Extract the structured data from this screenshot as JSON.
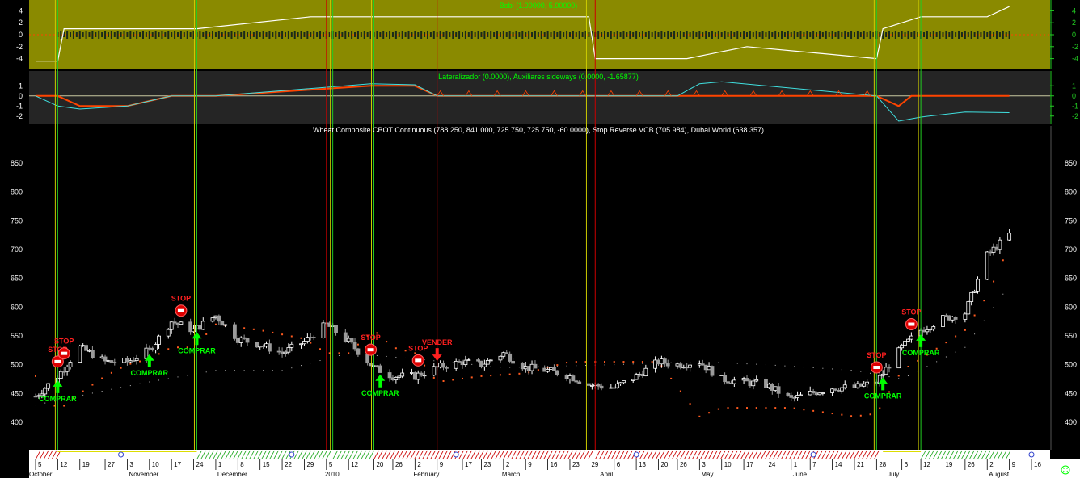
{
  "panels": {
    "bobi": {
      "title": "Bobi (1.00000, 5.00000)",
      "ticks": [
        "4",
        "2",
        "0",
        "-2",
        "-4"
      ],
      "tick_values": [
        4,
        2,
        0,
        -2,
        -4
      ],
      "bg_color": "#8a8a00"
    },
    "lateralizador": {
      "title": "Lateralizador (0.0000), Auxiliares sideways (0.0000, -1.65877)",
      "ticks": [
        "1",
        "0",
        "-1",
        "-2"
      ],
      "tick_values": [
        1,
        0,
        -1,
        -2
      ]
    },
    "price": {
      "title": "Wheat Composite CBOT Continuous (788.250, 841.000, 725.750, 725.750, -60.0000), Stop Reverse VCB (705.984), Dubai World (638.357)",
      "ticks": [
        "850",
        "800",
        "750",
        "700",
        "650",
        "600",
        "550",
        "500",
        "450",
        "400"
      ],
      "tick_values": [
        850,
        800,
        750,
        700,
        650,
        600,
        550,
        500,
        450,
        400
      ]
    }
  },
  "signals": [
    {
      "label": "COMPRAR",
      "kind": "buy",
      "date": "Oct 12"
    },
    {
      "label": "STOP",
      "kind": "stop",
      "date": "Oct 12"
    },
    {
      "label": "STOP",
      "kind": "stop",
      "date": "Oct 14"
    },
    {
      "label": "COMPRAR",
      "kind": "buy",
      "date": "Nov 10"
    },
    {
      "label": "STOP",
      "kind": "stop",
      "date": "Nov 20"
    },
    {
      "label": "COMPRAR",
      "kind": "buy",
      "date": "Nov 25"
    },
    {
      "label": "STOP",
      "kind": "stop",
      "date": "Jan 19"
    },
    {
      "label": "COMPRAR",
      "kind": "buy",
      "date": "Jan 22"
    },
    {
      "label": "STOP",
      "kind": "stop",
      "date": "Feb 3"
    },
    {
      "label": "VENDER",
      "kind": "sell",
      "date": "Feb 9"
    },
    {
      "label": "STOP",
      "kind": "stop",
      "date": "Jun 28"
    },
    {
      "label": "COMPRAR",
      "kind": "buy",
      "date": "Jun 30"
    },
    {
      "label": "STOP",
      "kind": "stop",
      "date": "Jul 9"
    },
    {
      "label": "COMPRAR",
      "kind": "buy",
      "date": "Jul 12"
    }
  ],
  "x_axis": {
    "day_ticks": [
      "5",
      "12",
      "19",
      "27",
      "3",
      "10",
      "17",
      "24",
      "1",
      "8",
      "15",
      "22",
      "29",
      "5",
      "12",
      "20",
      "26",
      "2",
      "9",
      "17",
      "23",
      "2",
      "9",
      "16",
      "23",
      "29",
      "6",
      "13",
      "20",
      "26",
      "3",
      "10",
      "17",
      "24",
      "1",
      "7",
      "14",
      "21",
      "28",
      "6",
      "12",
      "19",
      "26",
      "2",
      "9",
      "16"
    ],
    "months": [
      "October",
      "November",
      "December",
      "2010",
      "February",
      "March",
      "April",
      "May",
      "June",
      "July",
      "August"
    ]
  },
  "chart_data": [
    {
      "type": "line",
      "title": "Bobi (1.00000, 5.00000)",
      "ylim": [
        -5,
        5
      ],
      "series": [
        {
          "name": "Bobi",
          "color": "#ffffff",
          "x": [
            "Oct 5",
            "Oct 12",
            "Oct 14",
            "Nov 25",
            "Dec 31",
            "Jan 19",
            "Feb 9",
            "Mar 29",
            "Mar 31",
            "Apr 29",
            "May 18",
            "Jun 28",
            "Jun 30",
            "Jul 12",
            "Aug 2",
            "Aug 9"
          ],
          "values": [
            -4.4,
            -4.4,
            1.0,
            1.0,
            3.0,
            3.0,
            3.0,
            3.0,
            -4.0,
            -4.0,
            -2.0,
            -4.0,
            1.0,
            3.0,
            3.0,
            4.7
          ]
        }
      ]
    },
    {
      "type": "line",
      "title": "Lateralizador (0.0000), Auxiliares sideways (0.0000, -1.65877)",
      "ylim": [
        -2.5,
        1.5
      ],
      "series": [
        {
          "name": "Lateralizador",
          "color": "#ff4400",
          "x": [
            "Oct 5",
            "Oct 12",
            "Oct 19",
            "Nov 3",
            "Nov 17",
            "Dec 1",
            "Jan 19",
            "Feb 2",
            "Feb 9",
            "Jun 28",
            "Jul 5",
            "Jul 9",
            "Aug 9"
          ],
          "values": [
            0,
            0,
            -1,
            -1,
            0,
            0,
            1,
            1,
            0,
            0,
            -1,
            0,
            0
          ]
        },
        {
          "name": "Auxiliares sideways",
          "color": "#40e0e0",
          "x": [
            "Oct 5",
            "Oct 12",
            "Oct 19",
            "Nov 3",
            "Nov 17",
            "Dec 1",
            "Jan 19",
            "Feb 2",
            "Feb 9",
            "Apr 26",
            "May 3",
            "May 10",
            "Jun 28",
            "Jul 5",
            "Jul 12",
            "Jul 26",
            "Aug 9"
          ],
          "values": [
            0,
            -1.0,
            -1.3,
            -1.0,
            0,
            0,
            1.2,
            1.1,
            0,
            0,
            1.2,
            1.4,
            0,
            -2.5,
            -2.1,
            -1.6,
            -1.66
          ]
        }
      ]
    },
    {
      "type": "candlestick",
      "title": "Wheat Composite CBOT Continuous (788.250, 841.000, 725.750, 725.750, -60.0000), Stop Reverse VCB (705.984), Dubai World (638.357)",
      "ylim": [
        355,
        895
      ],
      "x_range": [
        "Oct 5",
        "Aug 16"
      ],
      "close_path": {
        "x": [
          "Oct 5",
          "Oct 12",
          "Oct 19",
          "Oct 27",
          "Nov 3",
          "Nov 10",
          "Nov 17",
          "Nov 24",
          "Dec 1",
          "Dec 8",
          "Dec 15",
          "Dec 22",
          "Dec 29",
          "Jan 5",
          "Jan 12",
          "Jan 20",
          "Jan 26",
          "Feb 2",
          "Feb 9",
          "Feb 17",
          "Feb 23",
          "Mar 2",
          "Mar 9",
          "Mar 16",
          "Mar 23",
          "Mar 29",
          "Apr 6",
          "Apr 13",
          "Apr 20",
          "Apr 26",
          "May 3",
          "May 10",
          "May 17",
          "May 24",
          "Jun 1",
          "Jun 7",
          "Jun 14",
          "Jun 21",
          "Jun 28",
          "Jul 6",
          "Jul 12",
          "Jul 19",
          "Jul 26",
          "Aug 2",
          "Aug 9"
        ],
        "values": [
          445,
          480,
          530,
          505,
          505,
          525,
          575,
          560,
          585,
          545,
          535,
          520,
          540,
          570,
          540,
          495,
          480,
          480,
          495,
          505,
          500,
          520,
          495,
          490,
          480,
          465,
          460,
          480,
          505,
          500,
          505,
          475,
          470,
          465,
          440,
          450,
          460,
          460,
          470,
          530,
          560,
          580,
          590,
          690,
          726
        ]
      },
      "stop_reverse_vcb": {
        "name": "Stop Reverse VCB",
        "color": "#ff5a1f",
        "x": [
          "Oct 5",
          "Oct 12",
          "Oct 19",
          "Oct 27",
          "Nov 3",
          "Nov 10",
          "Nov 17",
          "Nov 24",
          "Dec 1",
          "Dec 15",
          "Dec 29",
          "Jan 5",
          "Jan 12",
          "Jan 20",
          "Jan 26",
          "Feb 2",
          "Feb 9",
          "Feb 23",
          "Mar 9",
          "Mar 23",
          "Apr 6",
          "Apr 20",
          "May 3",
          "May 10",
          "Jun 1",
          "Jun 21",
          "Jun 28",
          "Jul 6",
          "Jul 12",
          "Jul 26",
          "Aug 2",
          "Aug 9"
        ],
        "values": [
          480,
          420,
          450,
          480,
          500,
          510,
          530,
          530,
          570,
          560,
          545,
          520,
          520,
          560,
          530,
          520,
          470,
          480,
          485,
          505,
          505,
          505,
          410,
          425,
          425,
          410,
          415,
          490,
          510,
          560,
          620,
          706
        ]
      },
      "dubai_world": {
        "name": "Dubai World",
        "color": "#bbbbbb",
        "x": [
          "Oct 5",
          "Oct 27",
          "Nov 10",
          "Dec 1",
          "Dec 22",
          "Jan 12",
          "Feb 2",
          "Mar 2",
          "Apr 6",
          "May 3",
          "May 24",
          "Jun 21",
          "Jul 6",
          "Jul 26",
          "Aug 9"
        ],
        "values": [
          430,
          455,
          470,
          490,
          490,
          520,
          510,
          495,
          500,
          505,
          500,
          490,
          475,
          530,
          638
        ]
      },
      "buy_lines": [
        "Oct 12",
        "Nov 25",
        "Jan 7",
        "Jan 20",
        "Mar 29",
        "Jun 28",
        "Jul 12"
      ],
      "sell_lines": [
        "Jan 5",
        "Feb 9",
        "Mar 31"
      ],
      "colors": {
        "bull": "#ffffff",
        "bear": "#9a9a9a",
        "buy_line": "#22cc22",
        "yellow_line": "#cccc00",
        "sell_line": "#cc0000"
      }
    }
  ]
}
